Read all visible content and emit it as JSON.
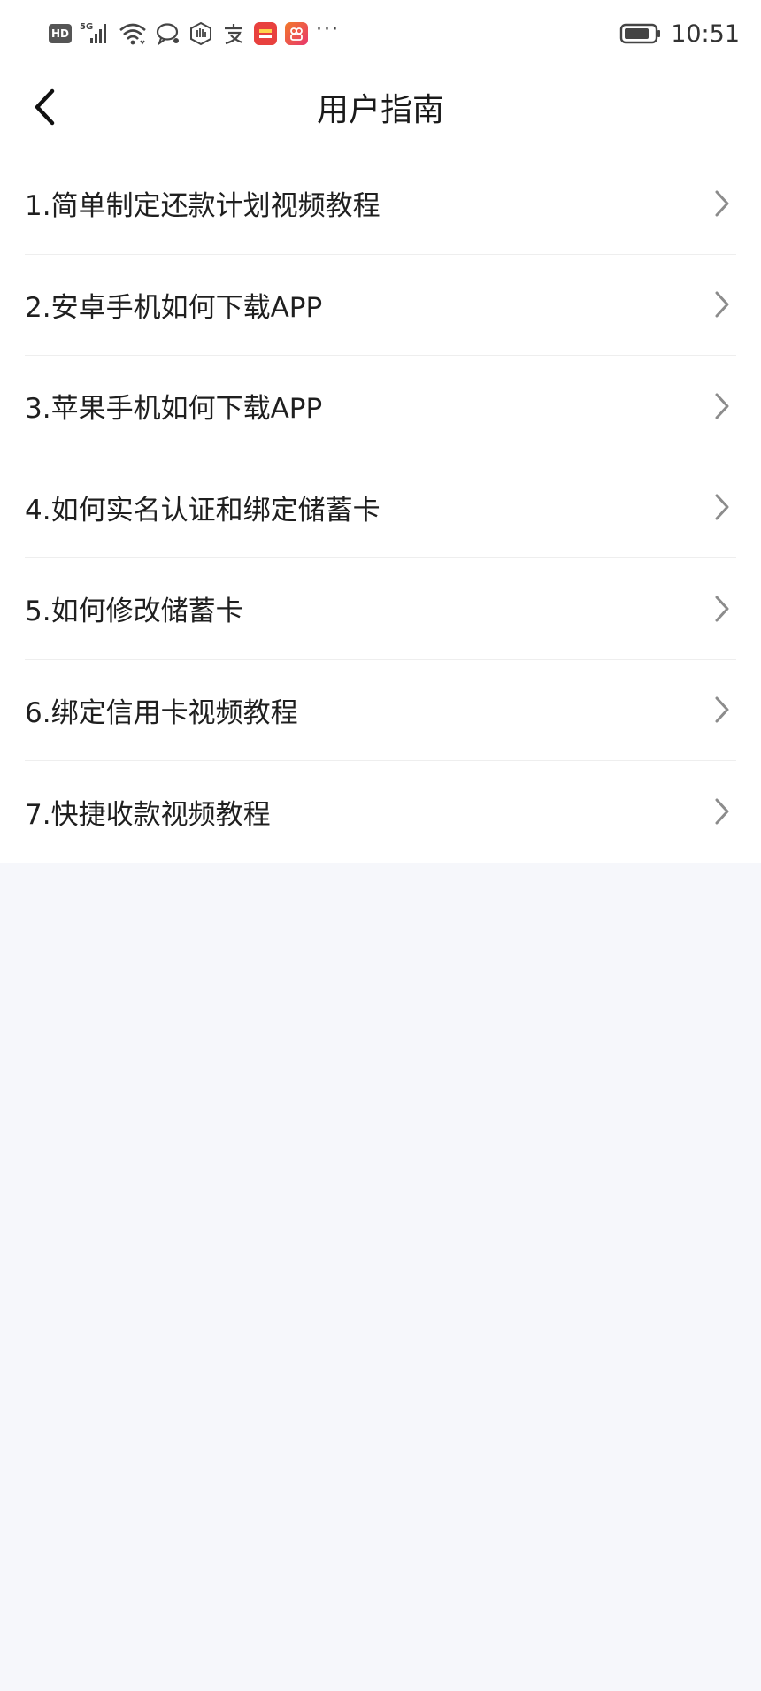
{
  "status_bar": {
    "left_icons": [
      "hd-icon",
      "5g-signal-icon",
      "wifi-icon",
      "chat-bubble-icon",
      "hand-icon",
      "alipay-icon",
      "red-app-icon",
      "pink-app-icon",
      "more-icon"
    ],
    "hd_label": "HD",
    "network_label": "5G",
    "more_label": "···",
    "time": "10:51"
  },
  "header": {
    "title": "用户指南",
    "back_icon": "chevron-left-icon"
  },
  "guide": {
    "items": [
      {
        "label": "1.简单制定还款计划视频教程"
      },
      {
        "label": "2.安卓手机如何下载APP"
      },
      {
        "label": "3.苹果手机如何下载APP"
      },
      {
        "label": "4.如何实名认证和绑定储蓄卡"
      },
      {
        "label": "5.如何修改储蓄卡"
      },
      {
        "label": "6.绑定信用卡视频教程"
      },
      {
        "label": "7.快捷收款视频教程"
      }
    ],
    "item_icon": "chevron-right-icon"
  },
  "colors": {
    "page_background": "#f6f7fb",
    "list_background": "#ffffff",
    "text": "#1f1f1f",
    "chevron": "#8c8c8c"
  }
}
